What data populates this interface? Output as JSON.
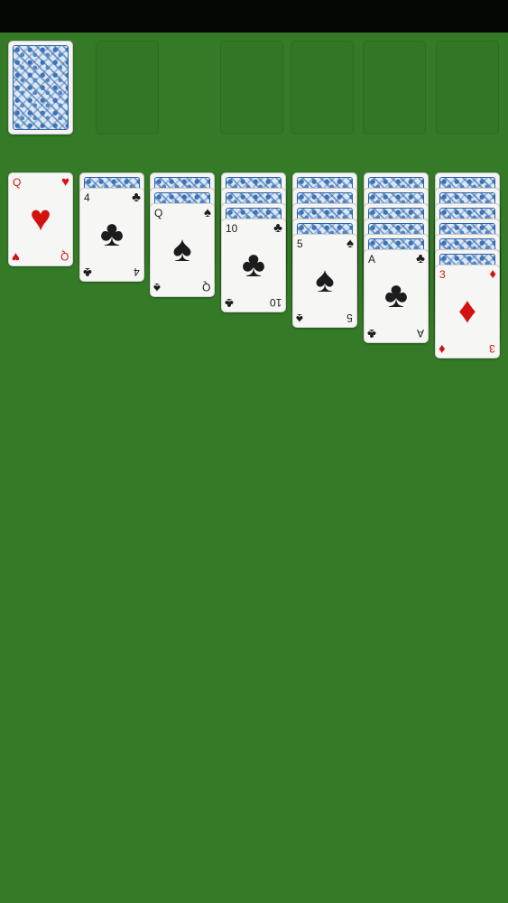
{
  "colors": {
    "felt": "#357a27",
    "statusbar": "#050705",
    "red_suit": "#d41111",
    "black_suit": "#1c1c1c",
    "card_back": "#2f64a5"
  },
  "stock": {
    "card": "face-down",
    "icon": "card-back-pattern"
  },
  "foundations": [
    "empty",
    "empty",
    "empty",
    "empty",
    "empty"
  ],
  "tableau": [
    {
      "face_down": 0,
      "face_up": {
        "rank": "Q",
        "suit": "♥",
        "color": "red"
      }
    },
    {
      "face_down": 1,
      "face_up": {
        "rank": "4",
        "suit": "♣",
        "color": "black"
      }
    },
    {
      "face_down": 2,
      "face_up": {
        "rank": "Q",
        "suit": "♠",
        "color": "black"
      }
    },
    {
      "face_down": 3,
      "face_up": {
        "rank": "10",
        "suit": "♣",
        "color": "black"
      }
    },
    {
      "face_down": 4,
      "face_up": {
        "rank": "5",
        "suit": "♠",
        "color": "black"
      }
    },
    {
      "face_down": 5,
      "face_up": {
        "rank": "A",
        "suit": "♣",
        "color": "black"
      }
    },
    {
      "face_down": 6,
      "face_up": {
        "rank": "3",
        "suit": "♦",
        "color": "red"
      }
    }
  ]
}
